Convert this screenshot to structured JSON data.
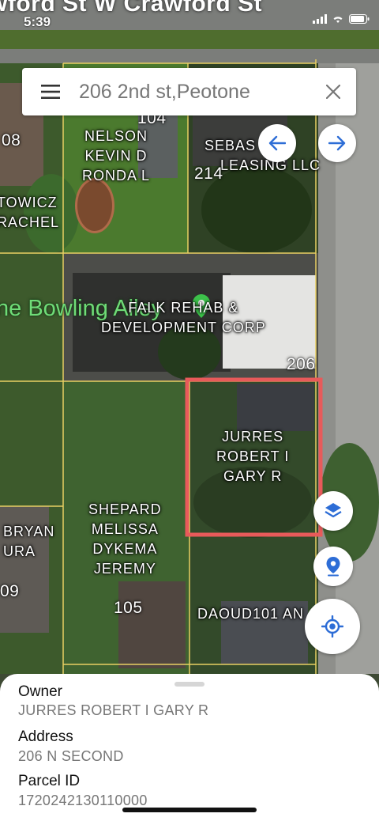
{
  "status_bar": {
    "time": "5:39"
  },
  "search": {
    "query": "206 2nd st,Peotone",
    "menu_icon": "hamburger-menu-icon",
    "clear_icon": "close-icon"
  },
  "map": {
    "street_label": "wford St  W Crawford St",
    "poi_name": "ne Bowling Alley",
    "owner_labels": {
      "nelson": [
        "NELSON",
        "KEVIN D",
        "RONDA L"
      ],
      "sebastian": [
        "SEBAS",
        "LEASING LLC"
      ],
      "kowicz": [
        "TOWICZ",
        "RACHEL"
      ],
      "rehab": [
        "FALK  REHAB &",
        "DEVELOPMENT CORP"
      ],
      "jurres": [
        "JURRES",
        "ROBERT I",
        "GARY R"
      ],
      "shepard": [
        "SHEPARD",
        "MELISSA",
        "DYKEMA",
        "JEREMY"
      ],
      "bryan": [
        "BRYAN",
        "URA"
      ],
      "daoud": "DAOUD101 AN"
    },
    "parcel_numbers": {
      "n104": "104",
      "n214": "214",
      "n108": "08",
      "n206": "206",
      "n105": "105",
      "n09": "09"
    },
    "selected_outline_color": "#e85a5a",
    "parcel_line_color": "#e8cf63"
  },
  "sheet": {
    "owner_label": "Owner",
    "owner_value": "JURRES ROBERT I GARY R",
    "address_label": "Address",
    "address_value": "206 N SECOND",
    "parcel_label": "Parcel ID",
    "parcel_value": "1720242130110000"
  }
}
